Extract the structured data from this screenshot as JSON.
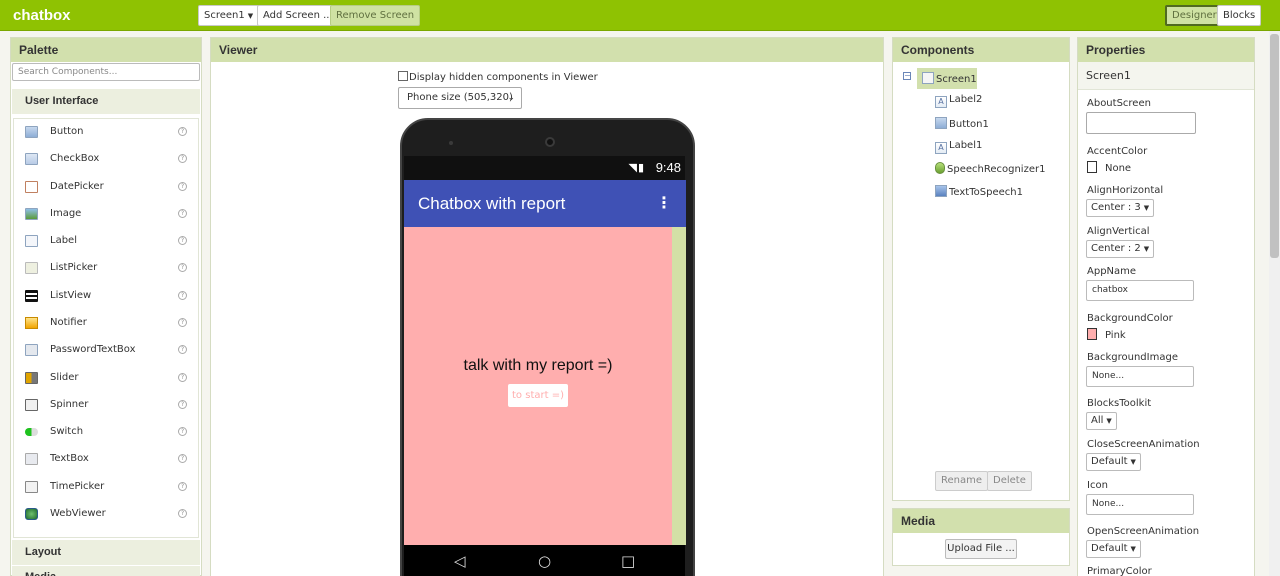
{
  "app": {
    "title": "chatbox"
  },
  "toolbar": {
    "screen_select": "Screen1",
    "add_screen": "Add Screen ...",
    "remove_screen": "Remove Screen",
    "designer": "Designer",
    "blocks": "Blocks"
  },
  "palette": {
    "title": "Palette",
    "search_placeholder": "Search Components...",
    "section_ui": "User Interface",
    "items": [
      {
        "label": "Button",
        "icon": "button-icon"
      },
      {
        "label": "CheckBox",
        "icon": "checkbox-icon"
      },
      {
        "label": "DatePicker",
        "icon": "datepicker-icon"
      },
      {
        "label": "Image",
        "icon": "image-icon"
      },
      {
        "label": "Label",
        "icon": "label-icon"
      },
      {
        "label": "ListPicker",
        "icon": "listpicker-icon"
      },
      {
        "label": "ListView",
        "icon": "listview-icon"
      },
      {
        "label": "Notifier",
        "icon": "notifier-icon"
      },
      {
        "label": "PasswordTextBox",
        "icon": "password-icon"
      },
      {
        "label": "Slider",
        "icon": "slider-icon"
      },
      {
        "label": "Spinner",
        "icon": "spinner-icon"
      },
      {
        "label": "Switch",
        "icon": "switch-icon"
      },
      {
        "label": "TextBox",
        "icon": "textbox-icon"
      },
      {
        "label": "TimePicker",
        "icon": "timepicker-icon"
      },
      {
        "label": "WebViewer",
        "icon": "webviewer-icon"
      }
    ],
    "help_glyph": "?",
    "section_layout": "Layout",
    "section_next": "Media"
  },
  "viewer": {
    "title": "Viewer",
    "hidden_checkbox_label": "Display hidden components in Viewer",
    "size_select": "Phone size (505,320)",
    "phone": {
      "time": "9:48",
      "app_title": "Chatbox with report",
      "menu_glyph": "⋮",
      "label_text": "talk with my report =)",
      "button_text": "to start =)",
      "screen_color": "#ffaeae",
      "appbar_color": "#3f51b5"
    }
  },
  "components": {
    "title": "Components",
    "tree": [
      {
        "label": "Screen1",
        "icon": "screen-icon"
      },
      {
        "label": "Label2",
        "icon": "label-icon"
      },
      {
        "label": "Button1",
        "icon": "button-icon"
      },
      {
        "label": "Label1",
        "icon": "label-icon"
      },
      {
        "label": "SpeechRecognizer1",
        "icon": "speech-recognizer-icon"
      },
      {
        "label": "TextToSpeech1",
        "icon": "text-to-speech-icon"
      }
    ],
    "rename": "Rename",
    "delete": "Delete"
  },
  "media": {
    "title": "Media",
    "upload": "Upload File ..."
  },
  "properties": {
    "title": "Properties",
    "component": "Screen1",
    "about_screen": {
      "label": "AboutScreen",
      "value": ""
    },
    "accent_color": {
      "label": "AccentColor",
      "value": "None",
      "swatch": "#ffffff"
    },
    "align_horizontal": {
      "label": "AlignHorizontal",
      "value": "Center : 3"
    },
    "align_vertical": {
      "label": "AlignVertical",
      "value": "Center : 2"
    },
    "app_name": {
      "label": "AppName",
      "value": "chatbox"
    },
    "background_color": {
      "label": "BackgroundColor",
      "value": "Pink",
      "swatch": "#ffaeae"
    },
    "background_image": {
      "label": "BackgroundImage",
      "value": "None..."
    },
    "blocks_toolkit": {
      "label": "BlocksToolkit",
      "value": "All"
    },
    "close_screen_animation": {
      "label": "CloseScreenAnimation",
      "value": "Default"
    },
    "icon": {
      "label": "Icon",
      "value": "None..."
    },
    "open_screen_animation": {
      "label": "OpenScreenAnimation",
      "value": "Default"
    },
    "primary_color": {
      "label": "PrimaryColor"
    }
  },
  "colors": {
    "topbar": "#8fc202",
    "panel_head": "#d2e0ad"
  }
}
